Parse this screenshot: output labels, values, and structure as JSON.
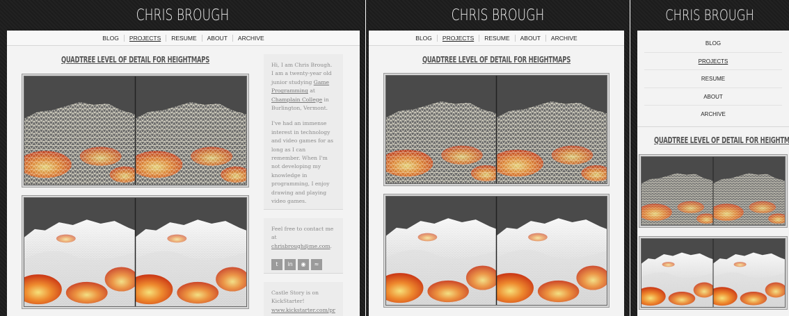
{
  "site": {
    "title": "CHRIS BROUGH"
  },
  "nav": {
    "items": [
      "BLOG",
      "PROJECTS",
      "RESUME",
      "ABOUT",
      "ARCHIVE"
    ],
    "active": "PROJECTS"
  },
  "post": {
    "title": "QUADTREE LEVEL OF DETAIL FOR HEIGHTMAPS"
  },
  "sidebar": {
    "intro_1": "Hi, I am Chris Brough. I am a twenty-year old junior studying ",
    "intro_link_1": "Game Programming",
    "intro_2": " at ",
    "intro_link_2": "Champlain College",
    "intro_3": " in Burlington, Vermont.",
    "interest": "I've had an immense interest in technology and video games for as long as I can remember. When I'm not developing my knowledge in programming, I enjoy drawing and playing video games.",
    "contact_prefix": "Feel free to contact me at ",
    "contact_email": "chrisbrough@me.com",
    "contact_suffix": ".",
    "social_icons": [
      "twitter-icon",
      "linkedin-icon",
      "github-icon",
      "rss-icon"
    ],
    "castle_1": "Castle Story is on KickStarter!",
    "castle_link": "www.kickstarter.com/pr"
  },
  "colors": {
    "header_bg": "#1f1f1f",
    "page_bg": "#f3f3f3",
    "title_text": "#555555",
    "terrain_red": "#d9441b",
    "terrain_yellow": "#f2d36b"
  }
}
